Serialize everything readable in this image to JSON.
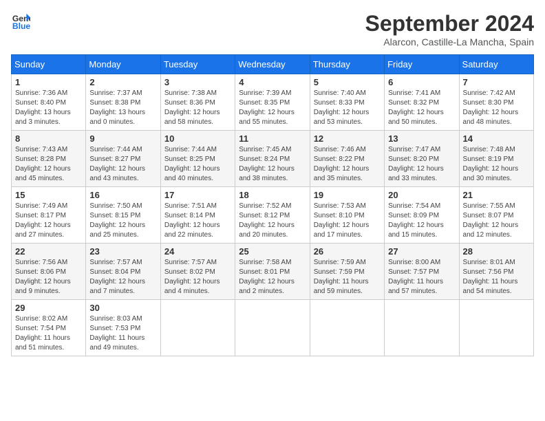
{
  "logo": {
    "line1": "General",
    "line2": "Blue"
  },
  "title": "September 2024",
  "location": "Alarcon, Castille-La Mancha, Spain",
  "weekdays": [
    "Sunday",
    "Monday",
    "Tuesday",
    "Wednesday",
    "Thursday",
    "Friday",
    "Saturday"
  ],
  "weeks": [
    [
      {
        "day": "1",
        "sunrise": "7:36 AM",
        "sunset": "8:40 PM",
        "daylight": "13 hours and 3 minutes."
      },
      {
        "day": "2",
        "sunrise": "7:37 AM",
        "sunset": "8:38 PM",
        "daylight": "13 hours and 0 minutes."
      },
      {
        "day": "3",
        "sunrise": "7:38 AM",
        "sunset": "8:36 PM",
        "daylight": "12 hours and 58 minutes."
      },
      {
        "day": "4",
        "sunrise": "7:39 AM",
        "sunset": "8:35 PM",
        "daylight": "12 hours and 55 minutes."
      },
      {
        "day": "5",
        "sunrise": "7:40 AM",
        "sunset": "8:33 PM",
        "daylight": "12 hours and 53 minutes."
      },
      {
        "day": "6",
        "sunrise": "7:41 AM",
        "sunset": "8:32 PM",
        "daylight": "12 hours and 50 minutes."
      },
      {
        "day": "7",
        "sunrise": "7:42 AM",
        "sunset": "8:30 PM",
        "daylight": "12 hours and 48 minutes."
      }
    ],
    [
      {
        "day": "8",
        "sunrise": "7:43 AM",
        "sunset": "8:28 PM",
        "daylight": "12 hours and 45 minutes."
      },
      {
        "day": "9",
        "sunrise": "7:44 AM",
        "sunset": "8:27 PM",
        "daylight": "12 hours and 43 minutes."
      },
      {
        "day": "10",
        "sunrise": "7:44 AM",
        "sunset": "8:25 PM",
        "daylight": "12 hours and 40 minutes."
      },
      {
        "day": "11",
        "sunrise": "7:45 AM",
        "sunset": "8:24 PM",
        "daylight": "12 hours and 38 minutes."
      },
      {
        "day": "12",
        "sunrise": "7:46 AM",
        "sunset": "8:22 PM",
        "daylight": "12 hours and 35 minutes."
      },
      {
        "day": "13",
        "sunrise": "7:47 AM",
        "sunset": "8:20 PM",
        "daylight": "12 hours and 33 minutes."
      },
      {
        "day": "14",
        "sunrise": "7:48 AM",
        "sunset": "8:19 PM",
        "daylight": "12 hours and 30 minutes."
      }
    ],
    [
      {
        "day": "15",
        "sunrise": "7:49 AM",
        "sunset": "8:17 PM",
        "daylight": "12 hours and 27 minutes."
      },
      {
        "day": "16",
        "sunrise": "7:50 AM",
        "sunset": "8:15 PM",
        "daylight": "12 hours and 25 minutes."
      },
      {
        "day": "17",
        "sunrise": "7:51 AM",
        "sunset": "8:14 PM",
        "daylight": "12 hours and 22 minutes."
      },
      {
        "day": "18",
        "sunrise": "7:52 AM",
        "sunset": "8:12 PM",
        "daylight": "12 hours and 20 minutes."
      },
      {
        "day": "19",
        "sunrise": "7:53 AM",
        "sunset": "8:10 PM",
        "daylight": "12 hours and 17 minutes."
      },
      {
        "day": "20",
        "sunrise": "7:54 AM",
        "sunset": "8:09 PM",
        "daylight": "12 hours and 15 minutes."
      },
      {
        "day": "21",
        "sunrise": "7:55 AM",
        "sunset": "8:07 PM",
        "daylight": "12 hours and 12 minutes."
      }
    ],
    [
      {
        "day": "22",
        "sunrise": "7:56 AM",
        "sunset": "8:06 PM",
        "daylight": "12 hours and 9 minutes."
      },
      {
        "day": "23",
        "sunrise": "7:57 AM",
        "sunset": "8:04 PM",
        "daylight": "12 hours and 7 minutes."
      },
      {
        "day": "24",
        "sunrise": "7:57 AM",
        "sunset": "8:02 PM",
        "daylight": "12 hours and 4 minutes."
      },
      {
        "day": "25",
        "sunrise": "7:58 AM",
        "sunset": "8:01 PM",
        "daylight": "12 hours and 2 minutes."
      },
      {
        "day": "26",
        "sunrise": "7:59 AM",
        "sunset": "7:59 PM",
        "daylight": "11 hours and 59 minutes."
      },
      {
        "day": "27",
        "sunrise": "8:00 AM",
        "sunset": "7:57 PM",
        "daylight": "11 hours and 57 minutes."
      },
      {
        "day": "28",
        "sunrise": "8:01 AM",
        "sunset": "7:56 PM",
        "daylight": "11 hours and 54 minutes."
      }
    ],
    [
      {
        "day": "29",
        "sunrise": "8:02 AM",
        "sunset": "7:54 PM",
        "daylight": "11 hours and 51 minutes."
      },
      {
        "day": "30",
        "sunrise": "8:03 AM",
        "sunset": "7:53 PM",
        "daylight": "11 hours and 49 minutes."
      },
      null,
      null,
      null,
      null,
      null
    ]
  ]
}
